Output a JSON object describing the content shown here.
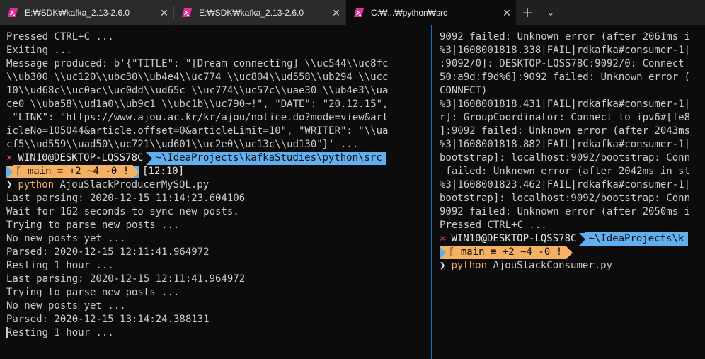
{
  "tabs": [
    {
      "title": "E:₩SDK₩kafka_2.13-2.6.0",
      "close": "✕",
      "active": false
    },
    {
      "title": "E:₩SDK₩kafka_2.13-2.6.0",
      "close": "✕",
      "active": false
    },
    {
      "title": "C:₩...₩python₩src",
      "close": "✕",
      "active": true
    }
  ],
  "tabbar": {
    "new_tab": "+",
    "dropdown": "⌄"
  },
  "left": {
    "pre": [
      "Pressed CTRL+C ...",
      "Exiting ...",
      "Message produced: b'{\"TITLE\": \"[Dream connecting] \\\\uc544\\\\uc8fc",
      "\\\\ub300 \\\\uc120\\\\ubc30\\\\ub4e4\\\\uc774 \\\\uc804\\\\ud558\\\\ub294 \\\\ucc",
      "10\\\\ud68c\\\\uc0ac\\\\uc0dd\\\\ud65c \\\\uc774\\\\uc57c\\\\uae30 \\\\ub4e3\\\\ua",
      "ce0 \\\\uba58\\\\ud1a0\\\\ub9c1 \\\\ubc1b\\\\uc790~!\", \"DATE\": \"20.12.15\",",
      " \"LINK\": \"https://www.ajou.ac.kr/kr/ajou/notice.do?mode=view&art",
      "icleNo=105044&article.offset=0&articleLimit=10\", \"WRITER\": \"\\\\ua",
      "cf5\\\\ud559\\\\uad50\\\\uc721\\\\ud601\\\\uc2e0\\\\uc13c\\\\ud130\"}' ..."
    ],
    "prompt": {
      "x": "×",
      "user": "WIN10@DESKTOP-LQSS78C",
      "path": "~\\IdeaProjects\\kafkaStudies\\python\\src",
      "git": "ᚴ main ≡ +2 ~4 -0 !",
      "time": "[12:10]"
    },
    "command": {
      "chev": "❯",
      "exe": "python",
      "arg": " AjouSlackProducerMySQL.py"
    },
    "post": [
      "Last parsing: 2020-12-15 11:14:23.604106",
      "Wait for 162 seconds to sync new posts.",
      "Trying to parse new posts ...",
      "No new posts yet ...",
      "Parsed: 2020-12-15 12:11:41.964972",
      "Resting 1 hour ...",
      "Last parsing: 2020-12-15 12:11:41.964972",
      "Trying to parse new posts ...",
      "No new posts yet ...",
      "Parsed: 2020-12-15 13:14:24.388131",
      "Resting 1 hour ..."
    ]
  },
  "right": {
    "pre": [
      "9092 failed: Unknown error (after 2061ms i",
      "%3|1608001818.338|FAIL|rdkafka#consumer-1|",
      ":9092/0]: DESKTOP-LQSS78C:9092/0: Connect",
      "50:a9d:f9d%6]:9092 failed: Unknown error (",
      "CONNECT)",
      "%3|1608001818.431|FAIL|rdkafka#consumer-1|",
      "r]: GroupCoordinator: Connect to ipv6#[fe8",
      "]:9092 failed: Unknown error (after 2043ms",
      "%3|1608001818.882|FAIL|rdkafka#consumer-1|",
      "bootstrap]: localhost:9092/bootstrap: Conn",
      " failed: Unknown error (after 2042ms in st",
      "%3|1608001823.462|FAIL|rdkafka#consumer-1|",
      "bootstrap]: localhost:9092/bootstrap: Conn",
      "9092 failed: Unknown error (after 2050ms i",
      "Pressed CTRL+C ..."
    ],
    "prompt": {
      "x": "×",
      "user": "WIN10@DESKTOP-LQSS78C",
      "path": "~\\IdeaProjects\\k",
      "git": "ᚴ main ≡ +2 ~4 -0 !"
    },
    "command": {
      "chev": "❯",
      "exe": "python",
      "arg": " AjouSlackConsumer.py"
    }
  }
}
